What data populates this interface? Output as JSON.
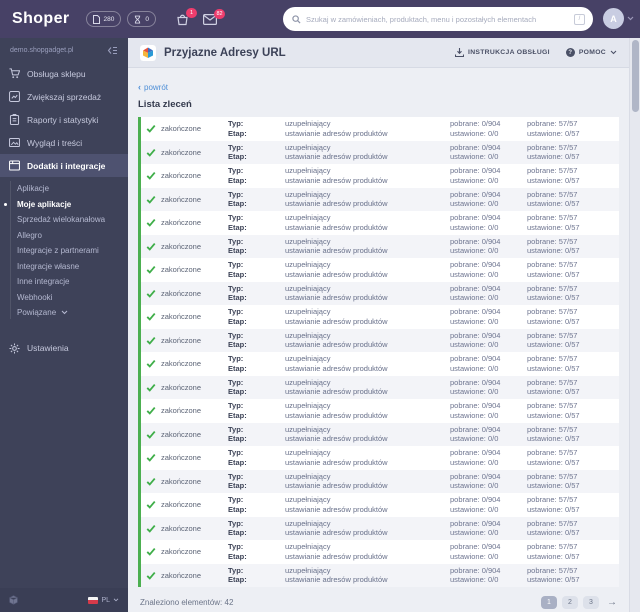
{
  "topbar": {
    "logo": "Shoper",
    "pills": [
      {
        "icon": "page-icon",
        "value": "280"
      },
      {
        "icon": "hourglass-icon",
        "value": "0"
      }
    ],
    "basket_badge": "1",
    "mail_badge": "82",
    "search_placeholder": "Szukaj w zamówieniach, produktach, menu i pozostałych elementach",
    "avatar_letter": "A"
  },
  "sidebar": {
    "shop_domain": "demo.shopgadget.pl",
    "items": [
      {
        "label": "Obsługa sklepu",
        "icon": "cart-icon"
      },
      {
        "label": "Zwiększaj sprzedaż",
        "icon": "chart-icon"
      },
      {
        "label": "Raporty i statystyki",
        "icon": "report-icon"
      },
      {
        "label": "Wygląd i treści",
        "icon": "image-icon"
      },
      {
        "label": "Dodatki i integracje",
        "icon": "plugin-icon",
        "active": true
      },
      {
        "label": "Ustawienia",
        "icon": "gear-icon"
      }
    ],
    "subitems": [
      "Aplikacje",
      "Moje aplikacje",
      "Sprzedaż wielokanałowa",
      "Allegro",
      "Integracje z partnerami",
      "Integracje własne",
      "Inne integracje",
      "Webhooki",
      "Powiązane"
    ],
    "active_subitem": "Moje aplikacje",
    "language": "PL"
  },
  "header": {
    "app_title": "Przyjazne Adresy URL",
    "manual_label": "INSTRUKCJA OBSŁUGI",
    "help_label": "POMOC"
  },
  "content": {
    "back_label": "powrót",
    "title": "Lista zleceń",
    "row_labels": {
      "typ": "Typ:",
      "etap": "Etap:"
    },
    "rows": [
      {
        "status": "zakończone",
        "typ": "uzupełniający",
        "etap": "ustawianie adresów produktów",
        "stat1_line1": "pobrane: 0/904",
        "stat1_line2": "ustawione: 0/0",
        "stat2_line1": "pobrane: 57/57",
        "stat2_line2": "ustawione: 0/57"
      },
      {
        "status": "zakończone",
        "typ": "uzupełniający",
        "etap": "ustawianie adresów produktów",
        "stat1_line1": "pobrane: 0/904",
        "stat1_line2": "ustawione: 0/0",
        "stat2_line1": "pobrane: 57/57",
        "stat2_line2": "ustawione: 0/57"
      },
      {
        "status": "zakończone",
        "typ": "uzupełniający",
        "etap": "ustawianie adresów produktów",
        "stat1_line1": "pobrane: 0/904",
        "stat1_line2": "ustawione: 0/0",
        "stat2_line1": "pobrane: 57/57",
        "stat2_line2": "ustawione: 0/57"
      },
      {
        "status": "zakończone",
        "typ": "uzupełniający",
        "etap": "ustawianie adresów produktów",
        "stat1_line1": "pobrane: 0/904",
        "stat1_line2": "ustawione: 0/0",
        "stat2_line1": "pobrane: 57/57",
        "stat2_line2": "ustawione: 0/57"
      },
      {
        "status": "zakończone",
        "typ": "uzupełniający",
        "etap": "ustawianie adresów produktów",
        "stat1_line1": "pobrane: 0/904",
        "stat1_line2": "ustawione: 0/0",
        "stat2_line1": "pobrane: 57/57",
        "stat2_line2": "ustawione: 0/57"
      },
      {
        "status": "zakończone",
        "typ": "uzupełniający",
        "etap": "ustawianie adresów produktów",
        "stat1_line1": "pobrane: 0/904",
        "stat1_line2": "ustawione: 0/0",
        "stat2_line1": "pobrane: 57/57",
        "stat2_line2": "ustawione: 0/57"
      },
      {
        "status": "zakończone",
        "typ": "uzupełniający",
        "etap": "ustawianie adresów produktów",
        "stat1_line1": "pobrane: 0/904",
        "stat1_line2": "ustawione: 0/0",
        "stat2_line1": "pobrane: 57/57",
        "stat2_line2": "ustawione: 0/57"
      },
      {
        "status": "zakończone",
        "typ": "uzupełniający",
        "etap": "ustawianie adresów produktów",
        "stat1_line1": "pobrane: 0/904",
        "stat1_line2": "ustawione: 0/0",
        "stat2_line1": "pobrane: 57/57",
        "stat2_line2": "ustawione: 0/57"
      },
      {
        "status": "zakończone",
        "typ": "uzupełniający",
        "etap": "ustawianie adresów produktów",
        "stat1_line1": "pobrane: 0/904",
        "stat1_line2": "ustawione: 0/0",
        "stat2_line1": "pobrane: 57/57",
        "stat2_line2": "ustawione: 0/57"
      },
      {
        "status": "zakończone",
        "typ": "uzupełniający",
        "etap": "ustawianie adresów produktów",
        "stat1_line1": "pobrane: 0/904",
        "stat1_line2": "ustawione: 0/0",
        "stat2_line1": "pobrane: 57/57",
        "stat2_line2": "ustawione: 0/57"
      },
      {
        "status": "zakończone",
        "typ": "uzupełniający",
        "etap": "ustawianie adresów produktów",
        "stat1_line1": "pobrane: 0/904",
        "stat1_line2": "ustawione: 0/0",
        "stat2_line1": "pobrane: 57/57",
        "stat2_line2": "ustawione: 0/57"
      },
      {
        "status": "zakończone",
        "typ": "uzupełniający",
        "etap": "ustawianie adresów produktów",
        "stat1_line1": "pobrane: 0/904",
        "stat1_line2": "ustawione: 0/0",
        "stat2_line1": "pobrane: 57/57",
        "stat2_line2": "ustawione: 0/57"
      },
      {
        "status": "zakończone",
        "typ": "uzupełniający",
        "etap": "ustawianie adresów produktów",
        "stat1_line1": "pobrane: 0/904",
        "stat1_line2": "ustawione: 0/0",
        "stat2_line1": "pobrane: 57/57",
        "stat2_line2": "ustawione: 0/57"
      },
      {
        "status": "zakończone",
        "typ": "uzupełniający",
        "etap": "ustawianie adresów produktów",
        "stat1_line1": "pobrane: 0/904",
        "stat1_line2": "ustawione: 0/0",
        "stat2_line1": "pobrane: 57/57",
        "stat2_line2": "ustawione: 0/57"
      },
      {
        "status": "zakończone",
        "typ": "uzupełniający",
        "etap": "ustawianie adresów produktów",
        "stat1_line1": "pobrane: 0/904",
        "stat1_line2": "ustawione: 0/0",
        "stat2_line1": "pobrane: 57/57",
        "stat2_line2": "ustawione: 0/57"
      },
      {
        "status": "zakończone",
        "typ": "uzupełniający",
        "etap": "ustawianie adresów produktów",
        "stat1_line1": "pobrane: 0/904",
        "stat1_line2": "ustawione: 0/0",
        "stat2_line1": "pobrane: 57/57",
        "stat2_line2": "ustawione: 0/57"
      },
      {
        "status": "zakończone",
        "typ": "uzupełniający",
        "etap": "ustawianie adresów produktów",
        "stat1_line1": "pobrane: 0/904",
        "stat1_line2": "ustawione: 0/0",
        "stat2_line1": "pobrane: 57/57",
        "stat2_line2": "ustawione: 0/57"
      },
      {
        "status": "zakończone",
        "typ": "uzupełniający",
        "etap": "ustawianie adresów produktów",
        "stat1_line1": "pobrane: 0/904",
        "stat1_line2": "ustawione: 0/0",
        "stat2_line1": "pobrane: 57/57",
        "stat2_line2": "ustawione: 0/57"
      },
      {
        "status": "zakończone",
        "typ": "uzupełniający",
        "etap": "ustawianie adresów produktów",
        "stat1_line1": "pobrane: 0/904",
        "stat1_line2": "ustawione: 0/0",
        "stat2_line1": "pobrane: 57/57",
        "stat2_line2": "ustawione: 0/57"
      },
      {
        "status": "zakończone",
        "typ": "uzupełniający",
        "etap": "ustawianie adresów produktów",
        "stat1_line1": "pobrane: 0/904",
        "stat1_line2": "ustawione: 0/0",
        "stat2_line1": "pobrane: 57/57",
        "stat2_line2": "ustawione: 0/57"
      }
    ],
    "footer": {
      "found_text": "Znaleziono elementów: 42",
      "pages": [
        "1",
        "2",
        "3"
      ],
      "active_page": "1"
    }
  }
}
